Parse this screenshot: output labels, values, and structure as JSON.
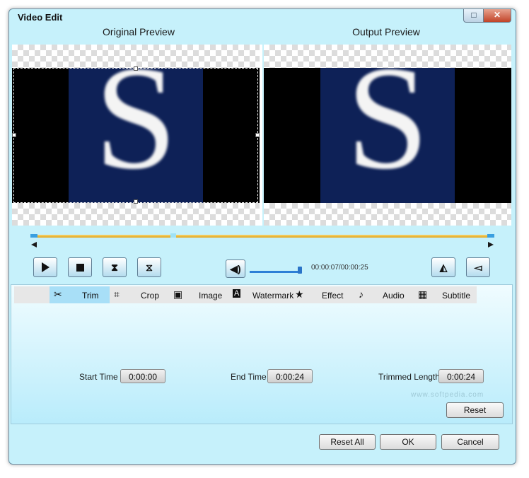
{
  "window": {
    "title": "Video Edit",
    "maximize_glyph": "□",
    "close_glyph": "✕"
  },
  "preview": {
    "original_title": "Original Preview",
    "output_title": "Output Preview",
    "frame_letter": "S"
  },
  "playback": {
    "time_display": "00:00:07/00:00:25",
    "progress": 0.28,
    "volume_level": 1.0
  },
  "tabs": [
    {
      "icon": "scissors-icon",
      "glyph": "✂",
      "label": "Trim",
      "active": true
    },
    {
      "icon": "crop-icon",
      "glyph": "⌗",
      "label": "Crop",
      "active": false
    },
    {
      "icon": "image-icon",
      "glyph": "▣",
      "label": "Image",
      "active": false
    },
    {
      "icon": "watermark-icon",
      "glyph": "A",
      "label": "Watermark",
      "active": false
    },
    {
      "icon": "star-icon",
      "glyph": "★",
      "label": "Effect",
      "active": false
    },
    {
      "icon": "music-note-icon",
      "glyph": "♪",
      "label": "Audio",
      "active": false
    },
    {
      "icon": "subtitle-icon",
      "glyph": "▦",
      "label": "Subtitle",
      "active": false
    }
  ],
  "trim": {
    "start_label": "Start Time",
    "start_value": "0:00:00",
    "end_label": "End Time",
    "end_value": "0:00:24",
    "length_label": "Trimmed Length",
    "length_value": "0:00:24",
    "reset_label": "Reset"
  },
  "watermark_text": "www.softpedia.com",
  "footer": {
    "reset_all": "Reset All",
    "ok": "OK",
    "cancel": "Cancel"
  },
  "colors": {
    "window_bg": "#c6f1fb",
    "tab_active": "#a8dff7",
    "timeline": "#e8b020",
    "accent": "#2d7fd6",
    "frame_bg": "#0e2157"
  }
}
